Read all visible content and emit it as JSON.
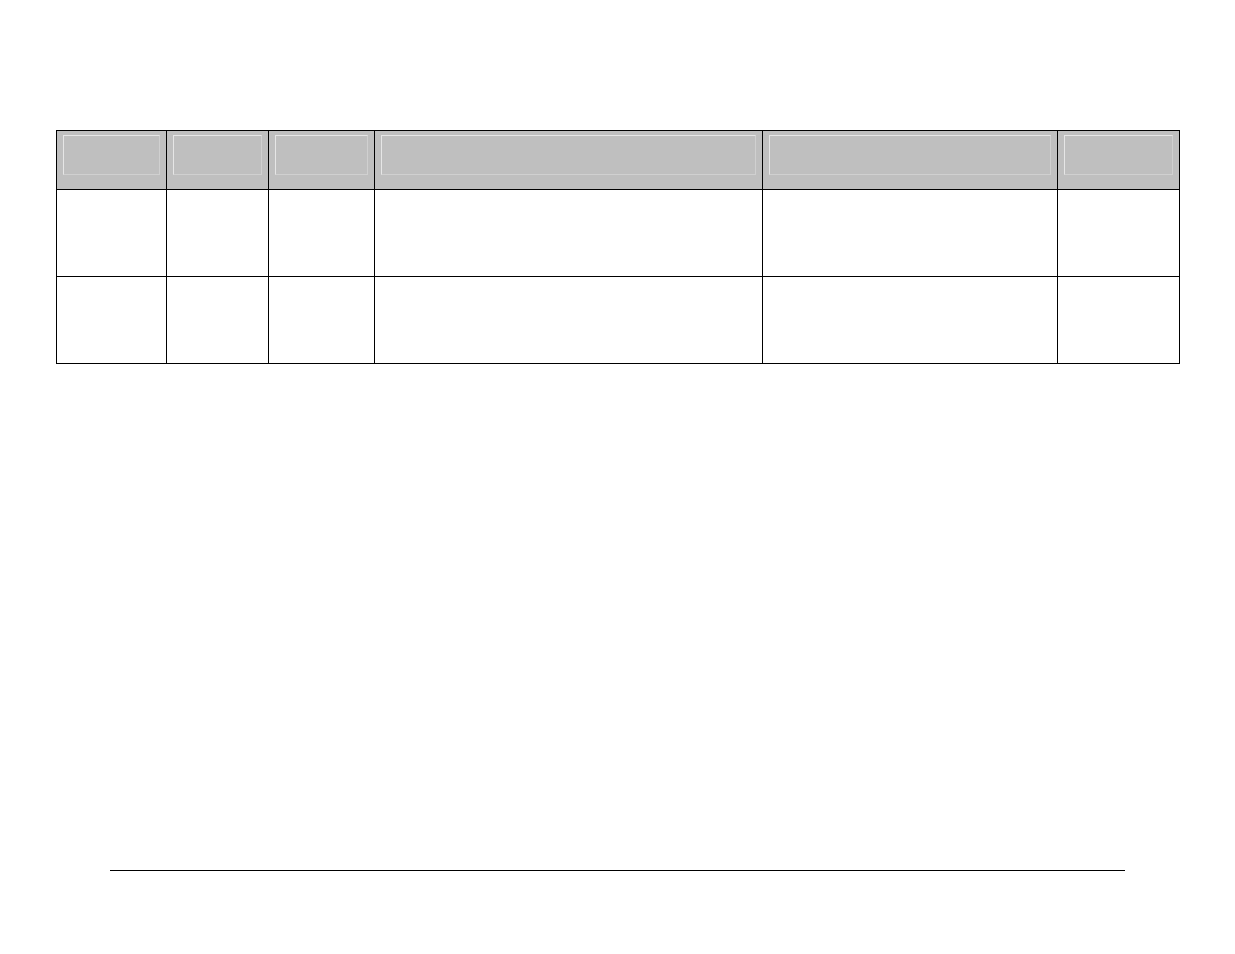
{
  "table": {
    "headers": [
      "",
      "",
      "",
      "",
      "",
      ""
    ],
    "rows": [
      [
        "",
        "",
        "",
        "",
        "",
        ""
      ],
      [
        "",
        "",
        "",
        "",
        "",
        ""
      ]
    ]
  }
}
